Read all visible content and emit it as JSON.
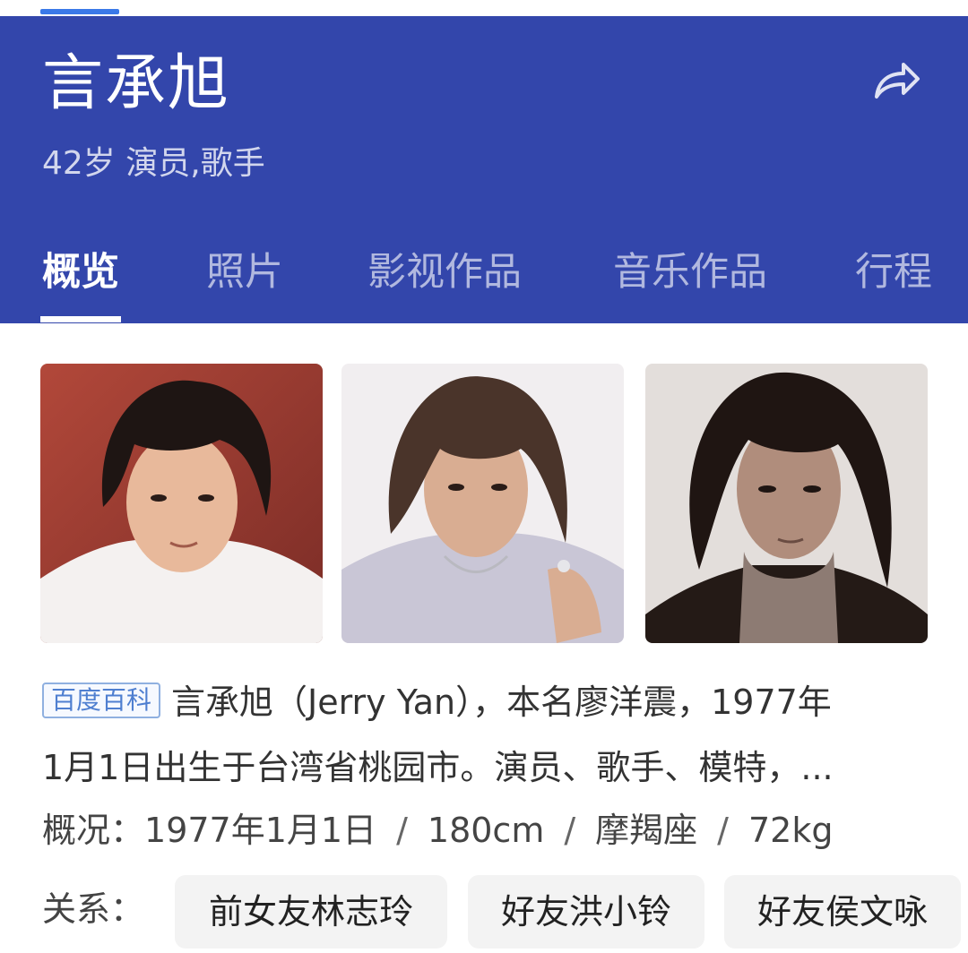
{
  "header": {
    "title": "言承旭",
    "subtitle": "42岁 演员,歌手",
    "share_icon": "share-arrow-icon",
    "background_color": "#3346ab"
  },
  "tabs": [
    {
      "label": "概览",
      "active": true
    },
    {
      "label": "照片",
      "active": false
    },
    {
      "label": "影视作品",
      "active": false
    },
    {
      "label": "音乐作品",
      "active": false
    },
    {
      "label": "行程",
      "active": false
    }
  ],
  "photos": [
    {
      "name": "portrait-photo-1"
    },
    {
      "name": "portrait-photo-2"
    },
    {
      "name": "portrait-photo-3"
    }
  ],
  "abstract": {
    "source_badge": "百度百科",
    "line1": "言承旭（Jerry Yan），本名廖洋震，1977年",
    "line2": "1月1日出生于台湾省桃园市。演员、歌手、模特，",
    "more": "..."
  },
  "overview": {
    "label": "概况：",
    "birthday": "1977年1月1日",
    "height": "180cm",
    "zodiac": "摩羯座",
    "weight": "72kg",
    "separator": "/"
  },
  "relations": {
    "label": "关系：",
    "items": [
      {
        "label": "前女友林志玲"
      },
      {
        "label": "好友洪小铃"
      },
      {
        "label": "好友侯文咏"
      }
    ]
  }
}
